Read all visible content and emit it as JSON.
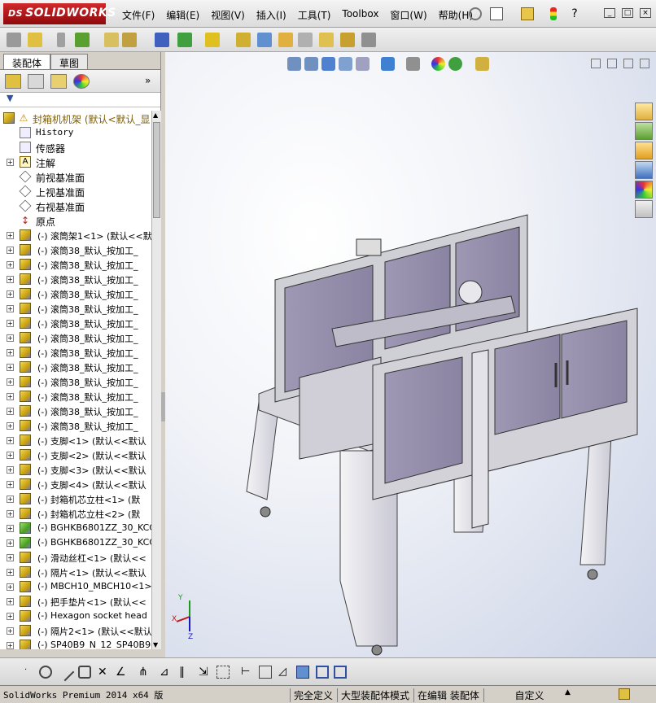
{
  "app": {
    "logo_text": "SOLIDWORKS",
    "logo_prefix": "DS"
  },
  "menu": [
    "文件(F)",
    "编辑(E)",
    "视图(V)",
    "插入(I)",
    "工具(T)",
    "Toolbox",
    "窗口(W)",
    "帮助(H)"
  ],
  "tabs": [
    "装配体",
    "草图"
  ],
  "tree": {
    "root": "封箱机机架  (默认<默认_显",
    "fixed_items": [
      {
        "label": "History",
        "expandable": false,
        "icon": "history-icon"
      },
      {
        "label": "传感器",
        "expandable": false,
        "icon": "sensor-icon"
      },
      {
        "label": "注解",
        "expandable": true,
        "icon": "annotation-icon"
      },
      {
        "label": "前视基准面",
        "expandable": false,
        "icon": "plane-icon"
      },
      {
        "label": "上视基准面",
        "expandable": false,
        "icon": "plane-icon"
      },
      {
        "label": "右视基准面",
        "expandable": false,
        "icon": "plane-icon"
      },
      {
        "label": "原点",
        "expandable": false,
        "icon": "origin-icon"
      }
    ],
    "components": [
      {
        "label": "(-) 滚筒架1<1> (默认<<默",
        "green": false
      },
      {
        "label": "(-) 滚筒38_默认_按加工_",
        "green": false
      },
      {
        "label": "(-) 滚筒38_默认_按加工_",
        "green": false
      },
      {
        "label": "(-) 滚筒38_默认_按加工_",
        "green": false
      },
      {
        "label": "(-) 滚筒38_默认_按加工_",
        "green": false
      },
      {
        "label": "(-) 滚筒38_默认_按加工_",
        "green": false
      },
      {
        "label": "(-) 滚筒38_默认_按加工_",
        "green": false
      },
      {
        "label": "(-) 滚筒38_默认_按加工_",
        "green": false
      },
      {
        "label": "(-) 滚筒38_默认_按加工_",
        "green": false
      },
      {
        "label": "(-) 滚筒38_默认_按加工_",
        "green": false
      },
      {
        "label": "(-) 滚筒38_默认_按加工_",
        "green": false
      },
      {
        "label": "(-) 滚筒38_默认_按加工_",
        "green": false
      },
      {
        "label": "(-) 滚筒38_默认_按加工_",
        "green": false
      },
      {
        "label": "(-) 滚筒38_默认_按加工_",
        "green": false
      },
      {
        "label": "(-) 支脚<1> (默认<<默认",
        "green": false
      },
      {
        "label": "(-) 支脚<2> (默认<<默认",
        "green": false
      },
      {
        "label": "(-) 支脚<3> (默认<<默认",
        "green": false
      },
      {
        "label": "(-) 支脚<4> (默认<<默认",
        "green": false
      },
      {
        "label": "(-) 封箱机芯立柱<1> (默",
        "green": false
      },
      {
        "label": "(-) 封箱机芯立柱<2> (默",
        "green": false
      },
      {
        "label": "(-) BGHKB6801ZZ_30_KCC_",
        "green": true
      },
      {
        "label": "(-) BGHKB6801ZZ_30_KCC_",
        "green": true
      },
      {
        "label": "(-) 滑动丝杠<1> (默认<<",
        "green": false
      },
      {
        "label": "(-) 隔片<1> (默认<<默认",
        "green": false
      },
      {
        "label": "(-) MBCH10_MBCH10<1> (",
        "green": false
      },
      {
        "label": "(-) 把手垫片<1> (默认<<",
        "green": false
      },
      {
        "label": "(-) Hexagon socket head",
        "green": false
      },
      {
        "label": "(-) 隔片2<1> (默认<<默认",
        "green": false
      },
      {
        "label": "(-) SP40B9_N_12_SP40B9-",
        "green": false
      }
    ]
  },
  "triad": {
    "x": "X",
    "y": "Y",
    "z": "Z"
  },
  "status": {
    "product": "SolidWorks Premium 2014 x64 版",
    "definition": "完全定义",
    "mode": "大型装配体模式",
    "editing": "在编辑 装配体",
    "custom": "自定义"
  },
  "colors": {
    "logo_red": "#c0181b",
    "part_purple": "#8f8aa6",
    "frame_gray": "#d8d8dc"
  }
}
